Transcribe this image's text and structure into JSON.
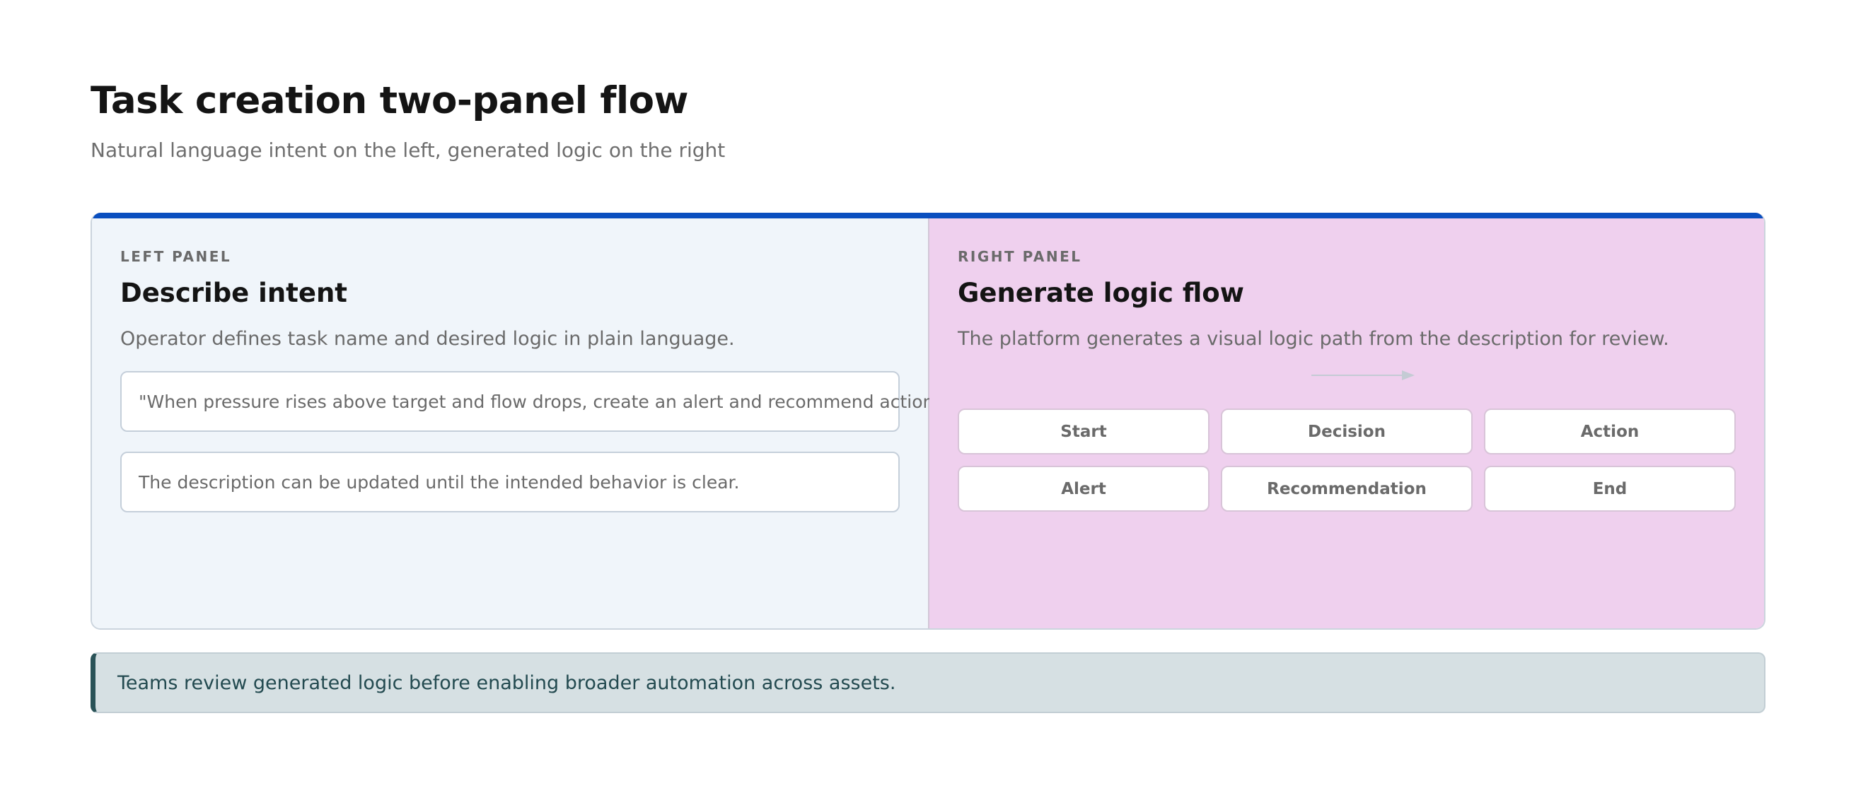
{
  "header": {
    "title": "Task creation two-panel flow",
    "subtitle": "Natural language intent on the left, generated logic on the right"
  },
  "left_panel": {
    "eyebrow": "LEFT PANEL",
    "heading": "Describe intent",
    "description": "Operator defines task name and desired logic in plain language.",
    "example_prompt": "\"When pressure rises above target and flow drops, create an alert and recommend action.\"",
    "hint": "The description can be updated until the intended behavior is clear."
  },
  "right_panel": {
    "eyebrow": "RIGHT PANEL",
    "heading": "Generate logic flow",
    "description": "The platform generates a visual logic path from the description for review.",
    "nodes": [
      "Start",
      "Decision",
      "Action",
      "Alert",
      "Recommendation",
      "End"
    ]
  },
  "footer_note": "Teams review generated logic before enabling broader automation across assets.",
  "colors": {
    "accent_bar": "#0a4fbf",
    "left_panel_bg": "#f0f5fa",
    "right_panel_bg": "#efd0ee",
    "note_bg": "#d6e0e3",
    "note_border": "#2a5358"
  }
}
